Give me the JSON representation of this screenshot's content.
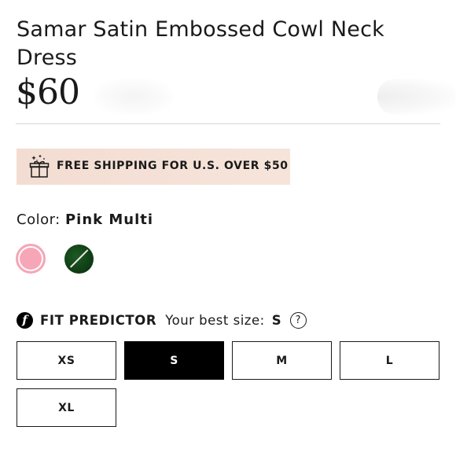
{
  "product": {
    "title": "Samar Satin Embossed Cowl Neck Dress",
    "price": "$60"
  },
  "promo": {
    "shipping_text": "FREE SHIPPING FOR U.S. OVER $50",
    "icon": "gift-box-icon",
    "background": "#f4e0d6"
  },
  "color": {
    "label": "Color:",
    "selected": "Pink Multi",
    "swatches": [
      {
        "name": "Pink Multi",
        "hex": "#f6a6b6",
        "selected": true
      },
      {
        "name": "Green",
        "hex": "#0f3d14",
        "selected": false
      }
    ]
  },
  "fit_predictor": {
    "logo_letter": "f",
    "label": "FIT PREDICTOR",
    "best_size_label": "Your best size:",
    "best_size": "S",
    "help": "?"
  },
  "sizes": [
    {
      "label": "XS",
      "selected": false
    },
    {
      "label": "S",
      "selected": true
    },
    {
      "label": "M",
      "selected": false
    },
    {
      "label": "L",
      "selected": false
    },
    {
      "label": "XL",
      "selected": false
    }
  ],
  "colors": {
    "text": "#1a1a1a",
    "selected_size_bg": "#000000",
    "divider": "#d4d4d4"
  }
}
